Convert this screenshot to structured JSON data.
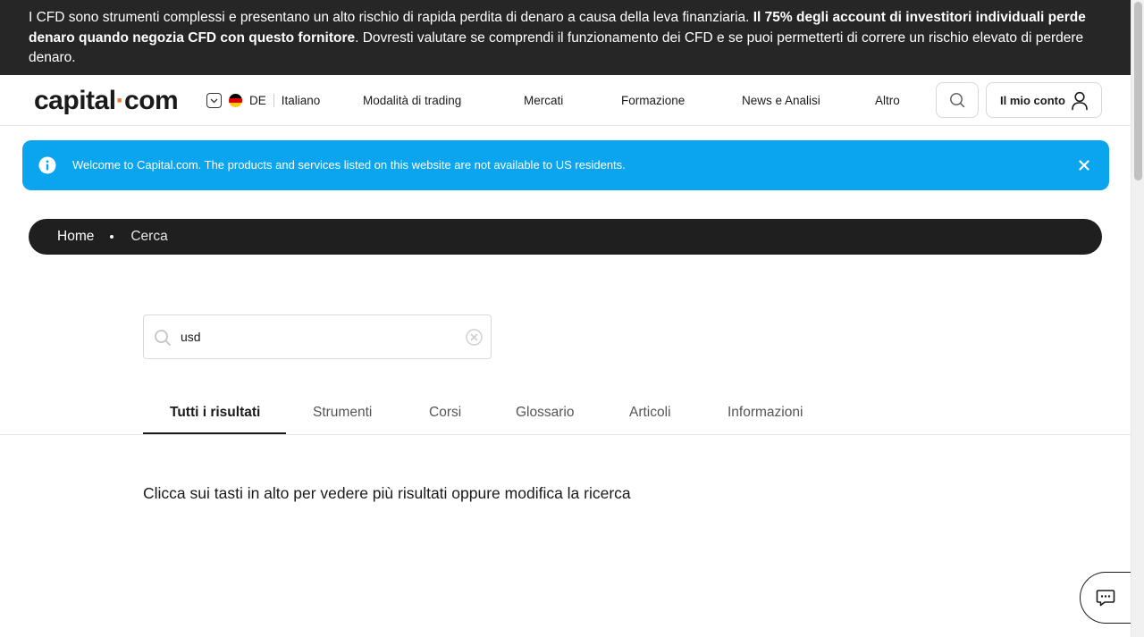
{
  "risk_warning": {
    "text_before": "I CFD sono strumenti complessi e presentano un alto rischio di rapida perdita di denaro a causa della leva finanziaria. ",
    "text_bold": "Il 75% degli account di investitori individuali perde denaro quando negozia CFD con questo fornitore",
    "text_after": ". Dovresti valutare se comprendi il funzionamento dei CFD e se puoi permetterti di correre un rischio elevato di perdere denaro."
  },
  "header": {
    "logo_left": "capital",
    "logo_dot": "·",
    "logo_right": "com",
    "country_code": "DE",
    "language": "Italiano",
    "nav": [
      "Modalità di trading",
      "Mercati",
      "Formazione",
      "News e Analisi",
      "Altro"
    ],
    "account_label": "Il mio conto"
  },
  "info_banner": {
    "text": "Welcome to Capital.com. The products and services listed on this website are not available to US residents."
  },
  "breadcrumb": {
    "home": "Home",
    "current": "Cerca"
  },
  "search": {
    "value": "usd"
  },
  "tabs": [
    "Tutti i risultati",
    "Strumenti",
    "Corsi",
    "Glossario",
    "Articoli",
    "Informazioni"
  ],
  "results": {
    "hint": "Clicca sui tasti in alto per vedere più risultati oppure modifica la ricerca"
  },
  "colors": {
    "brand_accent": "#e6782b",
    "info_banner": "#0ba5ef",
    "dark": "#1f1f1f"
  },
  "icons": [
    "chevron-down-icon",
    "flag-de-icon",
    "search-icon",
    "user-icon",
    "info-icon",
    "close-icon",
    "clear-icon",
    "chat-icon"
  ]
}
